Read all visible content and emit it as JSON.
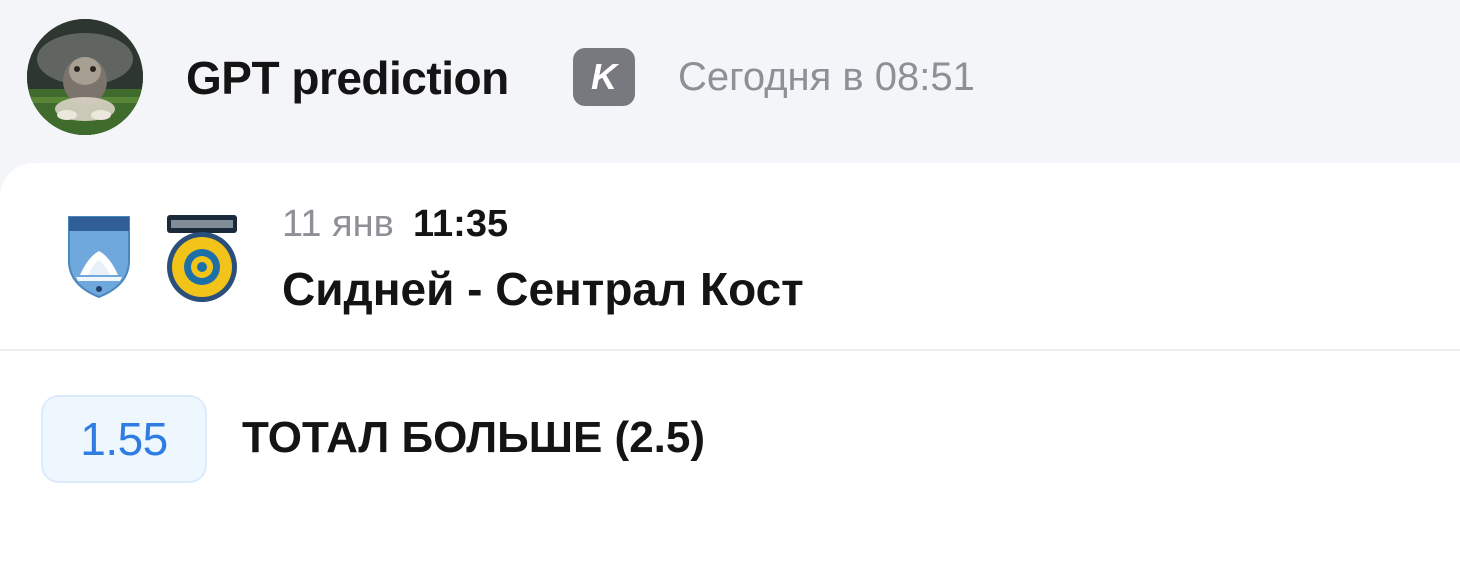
{
  "post": {
    "author": "GPT prediction",
    "source_badge_letter": "K",
    "timestamp": "Сегодня в 08:51"
  },
  "match": {
    "date": "11 янв",
    "time": "11:35",
    "title": "Сидней - Сентрал Кост",
    "home_logo_icon": "sydney-fc-crest-icon",
    "away_logo_icon": "central-coast-mariners-crest-icon"
  },
  "bet": {
    "odds": "1.55",
    "label": "ТОТАЛ БОЛЬШЕ (2.5)"
  },
  "colors": {
    "page_background": "#f4f5f8",
    "card_background": "#ffffff",
    "odds_text": "#2f7de3",
    "odds_background": "#eef6fe",
    "muted_text": "#8e9096",
    "source_badge": "#77797f"
  }
}
